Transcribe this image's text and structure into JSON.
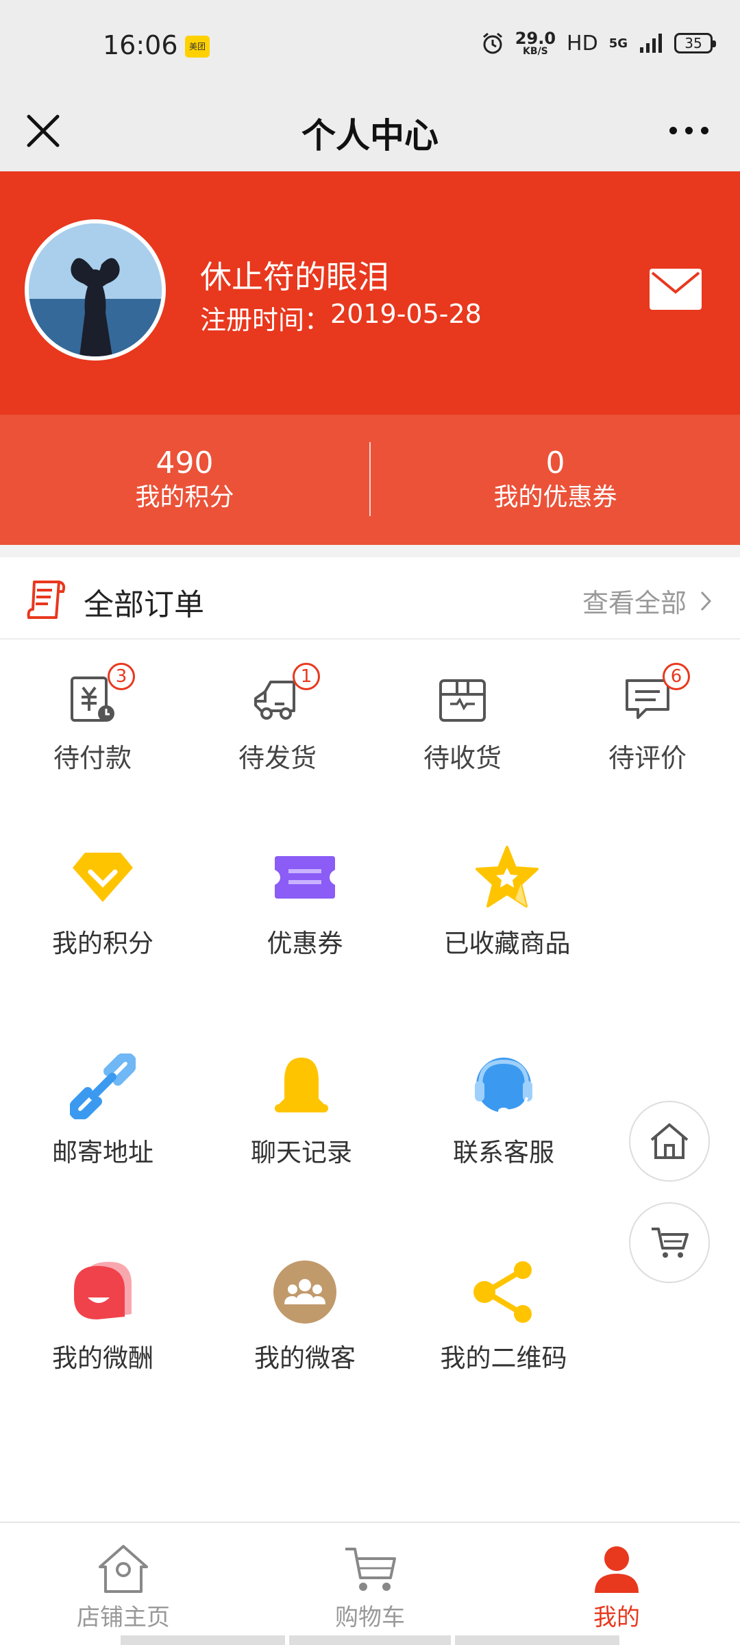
{
  "status_bar": {
    "time": "16:06",
    "app_badge": "美团",
    "speed_value": "29.0",
    "speed_unit": "KB/S",
    "hd": "HD",
    "network": "5G",
    "battery": "35"
  },
  "title_bar": {
    "title": "个人中心"
  },
  "profile": {
    "username": "休止符的眼泪",
    "reg_label": "注册时间：",
    "reg_date": "2019-05-28"
  },
  "stats": [
    {
      "value": "490",
      "label": "我的积分"
    },
    {
      "value": "0",
      "label": "我的优惠券"
    }
  ],
  "orders": {
    "title": "全部订单",
    "view_all": "查看全部",
    "items": [
      {
        "label": "待付款",
        "badge": "3"
      },
      {
        "label": "待发货",
        "badge": "1"
      },
      {
        "label": "待收货",
        "badge": ""
      },
      {
        "label": "待评价",
        "badge": "6"
      }
    ]
  },
  "tools": [
    {
      "label": "我的积分",
      "icon": "diamond-icon"
    },
    {
      "label": "优惠券",
      "icon": "coupon-icon"
    },
    {
      "label": "已收藏商品",
      "icon": "star-icon"
    },
    {
      "label": "邮寄地址",
      "icon": "link-icon"
    },
    {
      "label": "聊天记录",
      "icon": "bell-icon"
    },
    {
      "label": "联系客服",
      "icon": "headset-icon"
    },
    {
      "label": "我的微酬",
      "icon": "smile-icon"
    },
    {
      "label": "我的微客",
      "icon": "group-icon"
    },
    {
      "label": "我的二维码",
      "icon": "share-icon"
    }
  ],
  "bottom_nav": [
    {
      "label": "店铺主页",
      "icon": "shop-home-icon",
      "active": false
    },
    {
      "label": "购物车",
      "icon": "cart-icon",
      "active": false
    },
    {
      "label": "我的",
      "icon": "user-icon",
      "active": true
    }
  ],
  "colors": {
    "brand_red": "#e8381e",
    "stats_red": "#eb5238",
    "diamond_yellow": "#ffc400",
    "coupon_purple": "#8b5cf6",
    "link_blue": "#3b9af0",
    "group_brown": "#c19a6b",
    "smile_red": "#f0424b"
  }
}
